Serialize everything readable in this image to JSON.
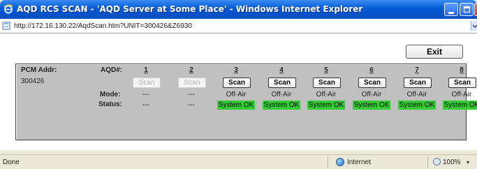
{
  "window": {
    "title": "AQD RCS SCAN - 'AQD Server at Some Place' - Windows Internet Explorer"
  },
  "address_bar": {
    "url": "http://172.16.130.22/AqdScan.htm?UNIT=300426&Z6930"
  },
  "toolbar": {
    "exit_label": "Exit"
  },
  "panel": {
    "pcm_addr_label": "PCM Addr:",
    "pcm_addr_value": "300426",
    "aqd_label": "AQD#:",
    "mode_label": "Mode:",
    "status_label": "Status:",
    "units": [
      {
        "num": "1",
        "scan": "Scan",
        "scan_enabled": false,
        "mode": "---",
        "status": "---",
        "status_ok": false
      },
      {
        "num": "2",
        "scan": "Scan",
        "scan_enabled": false,
        "mode": "---",
        "status": "---",
        "status_ok": false
      },
      {
        "num": "3",
        "scan": "Scan",
        "scan_enabled": true,
        "mode": "Off-Air",
        "status": "System OK",
        "status_ok": true
      },
      {
        "num": "4",
        "scan": "Scan",
        "scan_enabled": true,
        "mode": "Off-Air",
        "status": "System OK",
        "status_ok": true
      },
      {
        "num": "5",
        "scan": "Scan",
        "scan_enabled": true,
        "mode": "Off-Air",
        "status": "System OK",
        "status_ok": true
      },
      {
        "num": "6",
        "scan": "Scan",
        "scan_enabled": true,
        "mode": "Off-Air",
        "status": "System OK",
        "status_ok": true
      },
      {
        "num": "7",
        "scan": "Scan",
        "scan_enabled": true,
        "mode": "Off-Air",
        "status": "System OK",
        "status_ok": true
      },
      {
        "num": "8",
        "scan": "Scan",
        "scan_enabled": true,
        "mode": "Off-Air",
        "status": "System OK",
        "status_ok": true
      }
    ]
  },
  "status_bar": {
    "done": "Done",
    "zone": "Internet",
    "zoom": "100%"
  },
  "colors": {
    "status_ok": "#33cc33",
    "panel_bg": "#c0c0c0",
    "titlebar": "#0a5fd8"
  },
  "icons": {
    "title": "ie-logo-icon",
    "page": "page-icon",
    "zone": "globe-icon",
    "zoom": "zoom-icon"
  }
}
